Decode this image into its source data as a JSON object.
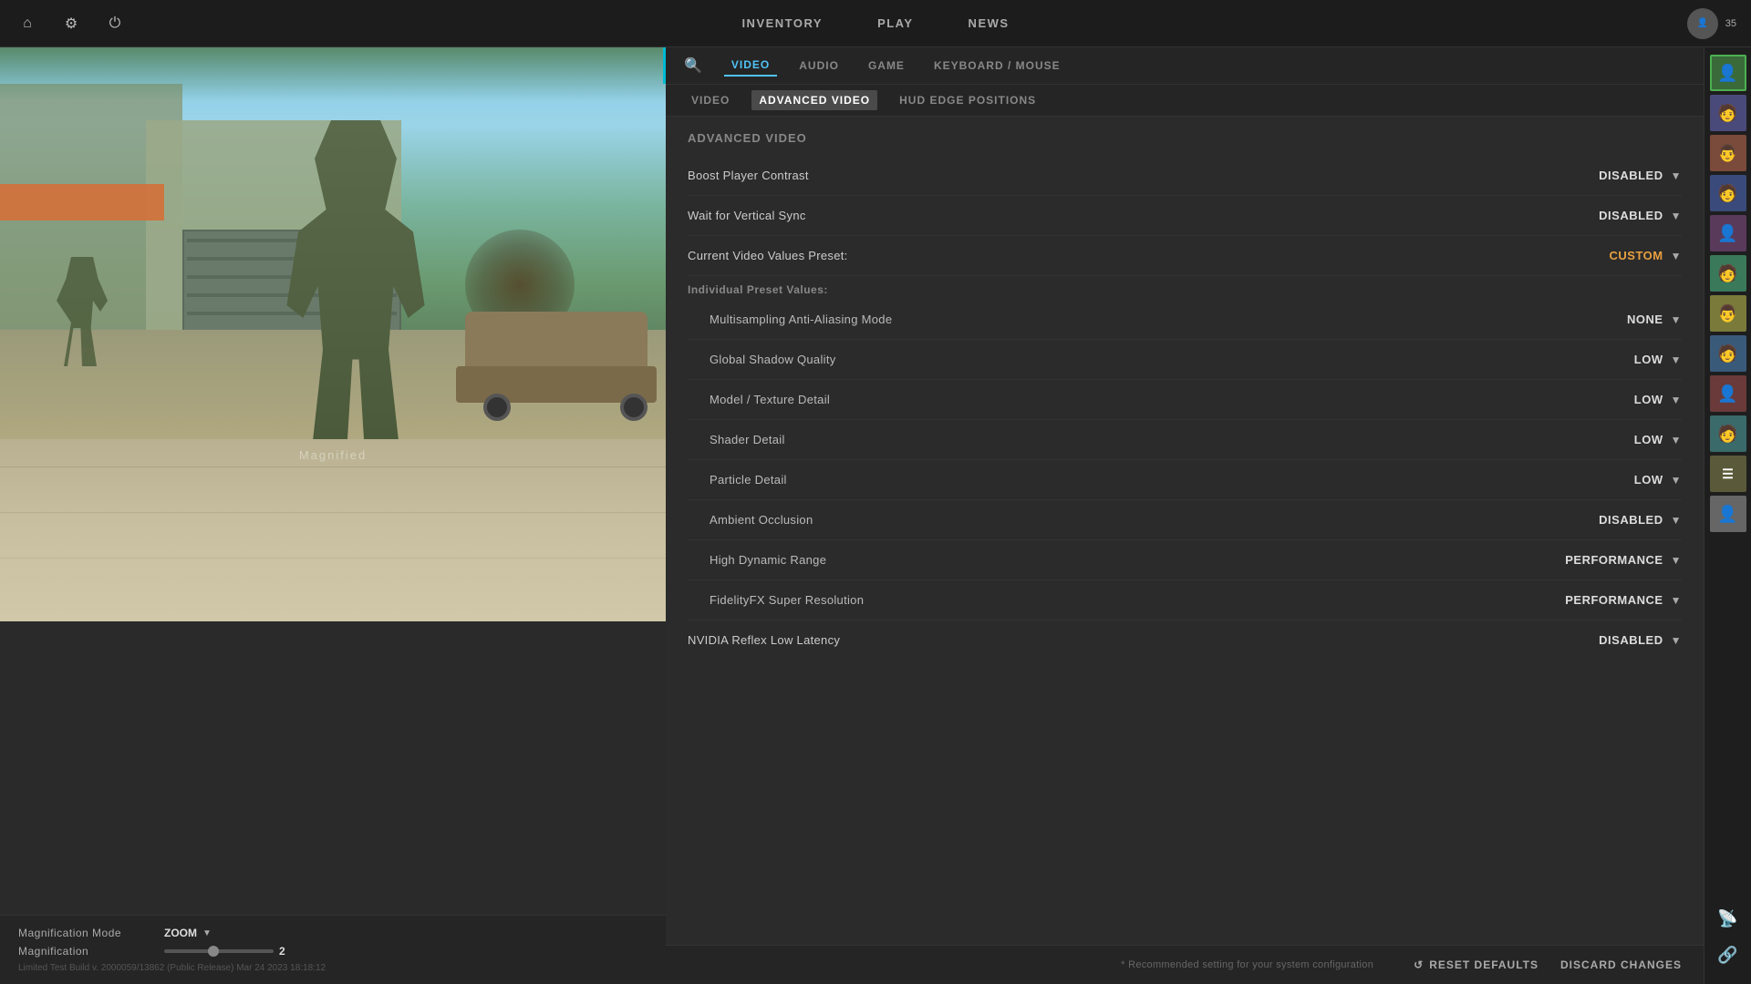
{
  "topbar": {
    "home_icon": "⌂",
    "settings_icon": "⚙",
    "power_icon": "⏻",
    "nav_items": [
      "INVENTORY",
      "PLAY",
      "NEWS"
    ],
    "level": "35"
  },
  "tabs_row1": {
    "search_icon": "🔍",
    "items": [
      "VIDEO",
      "AUDIO",
      "GAME",
      "KEYBOARD / MOUSE"
    ],
    "active": "VIDEO"
  },
  "tabs_row2": {
    "items": [
      "VIDEO",
      "ADVANCED VIDEO",
      "HUD EDGE POSITIONS"
    ],
    "active": "ADVANCED VIDEO"
  },
  "settings": {
    "section_title": "Advanced Video",
    "rows": [
      {
        "label": "Boost Player Contrast",
        "value": "DISABLED",
        "indented": false
      },
      {
        "label": "Wait for Vertical Sync",
        "value": "DISABLED",
        "indented": false
      },
      {
        "label": "Current Video Values Preset:",
        "value": "CUSTOM",
        "indented": false
      },
      {
        "subsection": "Individual Preset Values:"
      },
      {
        "label": "Multisampling Anti-Aliasing Mode",
        "value": "NONE",
        "indented": true
      },
      {
        "label": "Global Shadow Quality",
        "value": "LOW",
        "indented": true
      },
      {
        "label": "Model / Texture Detail",
        "value": "LOW",
        "indented": true
      },
      {
        "label": "Shader Detail",
        "value": "LOW",
        "indented": true
      },
      {
        "label": "Particle Detail",
        "value": "LOW",
        "indented": true
      },
      {
        "label": "Ambient Occlusion",
        "value": "DISABLED",
        "indented": true
      },
      {
        "label": "High Dynamic Range",
        "value": "PERFORMANCE",
        "indented": true
      },
      {
        "label": "FidelityFX Super Resolution",
        "value": "PERFORMANCE",
        "indented": true
      }
    ],
    "nvidia_row": {
      "label": "NVIDIA Reflex Low Latency",
      "value": "DISABLED"
    }
  },
  "bottom_controls": {
    "magnification_mode_label": "Magnification Mode",
    "magnification_mode_value": "ZOOM",
    "magnification_label": "Magnification",
    "magnification_value": "2",
    "magnified_label": "Magnified",
    "version_text": "Limited Test Build v. 2000059/13862 (Public Release) Mar 24 2023 18:18:12"
  },
  "bottom_actions": {
    "recommended_text": "* Recommended setting for your system configuration",
    "reset_icon": "↺",
    "reset_label": "RESET DEFAULTS",
    "discard_label": "DISCARD CHANGES"
  },
  "sidebar_avatars": [
    {
      "color": "#4a9a4a",
      "green": true
    },
    {
      "color": "#5a5a8a"
    },
    {
      "color": "#8a5a4a"
    },
    {
      "color": "#4a5a8a"
    },
    {
      "color": "#6a4a6a"
    },
    {
      "color": "#4a8a6a"
    },
    {
      "color": "#8a8a4a"
    },
    {
      "color": "#4a6a8a"
    },
    {
      "color": "#7a4a4a"
    },
    {
      "color": "#4a7a7a"
    },
    {
      "color": "#6a6a4a"
    },
    {
      "color": "#888"
    },
    {
      "color": "#666"
    }
  ],
  "sidebar_bottom_icons": [
    "📡",
    "🔗"
  ]
}
